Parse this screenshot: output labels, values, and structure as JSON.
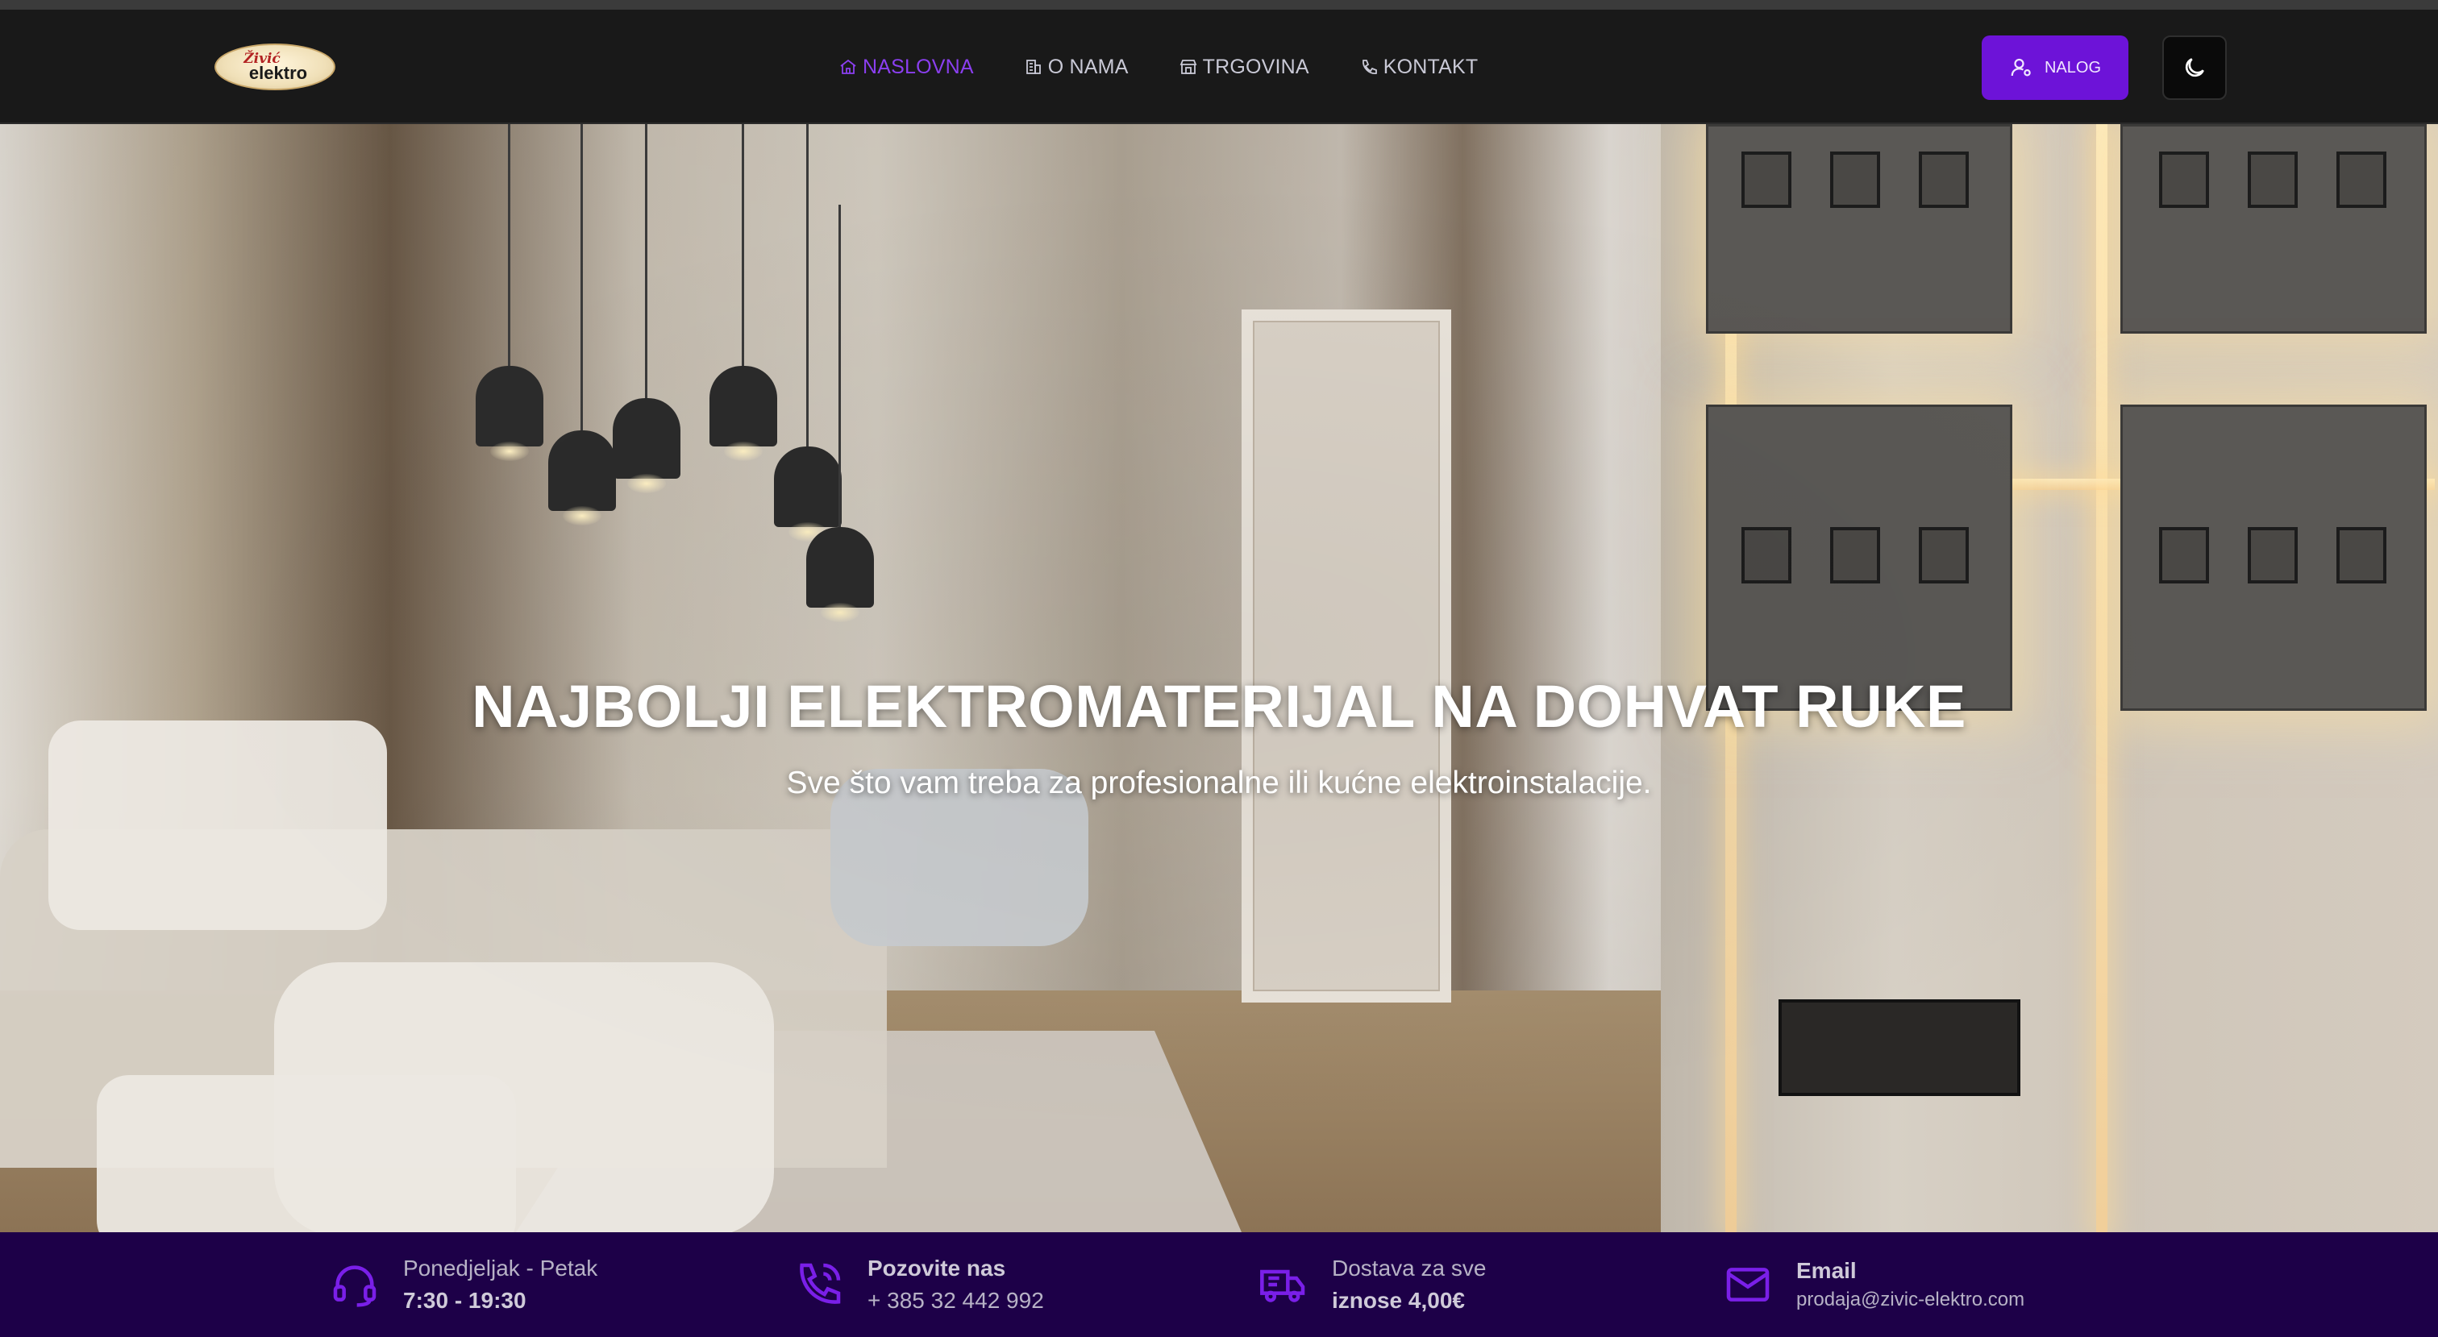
{
  "brand": {
    "logo_line1": "Živić",
    "logo_line2": "elektro"
  },
  "nav": {
    "items": [
      {
        "label": "NASLOVNA",
        "icon": "home-icon",
        "active": true
      },
      {
        "label": "O NAMA",
        "icon": "building-icon",
        "active": false
      },
      {
        "label": "TRGOVINA",
        "icon": "store-icon",
        "active": false
      },
      {
        "label": "KONTAKT",
        "icon": "phone-icon",
        "active": false
      }
    ],
    "account_button": "NALOG",
    "theme_toggle_icon": "moon-icon"
  },
  "hero": {
    "title": "NAJBOLJI ELEKTROMATERIJAL NA DOHVAT RUKE",
    "subtitle": "Sve što vam treba za profesionalne ili kućne elektroinstalacije."
  },
  "info": {
    "hours": {
      "icon": "headset-icon",
      "line1": "Ponedjeljak - Petak",
      "line2": "7:30 - 19:30"
    },
    "phone": {
      "icon": "phone-call-icon",
      "line1": "Pozovite nas",
      "line2": "+ 385 32 442 992"
    },
    "delivery": {
      "icon": "truck-icon",
      "line1": "Dostava za sve",
      "line2": "iznose 4,00€"
    },
    "email": {
      "icon": "mail-icon",
      "line1": "Email",
      "line2": "prodaja@zivic-elektro.com"
    }
  },
  "colors": {
    "accent": "#6d13d8",
    "active_link": "#8b3ff0",
    "navbar_bg": "#191919",
    "infobar_bg": "#1d0048"
  }
}
